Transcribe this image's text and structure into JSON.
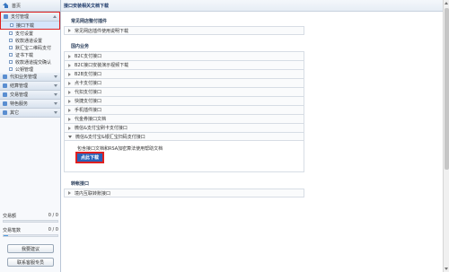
{
  "home": {
    "label": "首页"
  },
  "sidebar": {
    "groups": [
      {
        "label": "支付管理",
        "expanded": true,
        "items": [
          {
            "label": "接口下载",
            "active": true
          },
          {
            "label": "支付设置"
          },
          {
            "label": "收款通道设置"
          },
          {
            "label": "默汇宝二维码支付"
          },
          {
            "label": "证书下载"
          },
          {
            "label": "收款通道提交确认"
          },
          {
            "label": "公钥管理"
          }
        ]
      },
      {
        "label": "代扣业务管理"
      },
      {
        "label": "结算管理"
      },
      {
        "label": "交易管理"
      },
      {
        "label": "特色服务"
      },
      {
        "label": "其它"
      }
    ],
    "stats": [
      {
        "label": "交易额",
        "value": "0 / 0",
        "fill": 0.0
      },
      {
        "label": "交易笔数",
        "value": "0 / 0",
        "fill": 0.08
      }
    ],
    "buttons": {
      "feedback": "我要建议",
      "contact": "联系客服专员"
    }
  },
  "main": {
    "title": "接口安装相关文档下载",
    "sections": [
      {
        "title": "常见网店整付插件",
        "rows": [
          "常见网店插件使用说明下载"
        ]
      },
      {
        "title": "国内业务",
        "rows": [
          "B2C支付接口",
          "B2C接口安装演示视频下载",
          "B2B支付接口",
          "点卡支付接口",
          "代扣支付接口",
          "快捷支付接口",
          "手机插件接口",
          "代金券接口文档",
          "微信&支付宝刷卡支付接口",
          "微信&支付宝&银汇宝扫码支付接口"
        ],
        "expanded": {
          "text": "包含接口文档和RSA加密算法使用帮助文档",
          "button": "点此下载"
        }
      },
      {
        "title": "转帐接口",
        "rows": [
          "境内互联转账接口"
        ]
      }
    ]
  }
}
